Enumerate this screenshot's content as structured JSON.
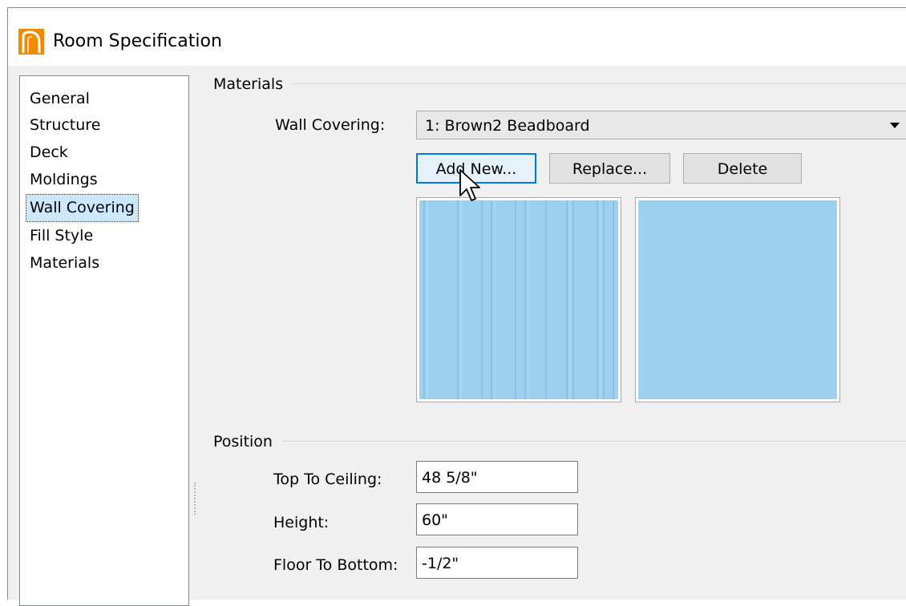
{
  "window": {
    "title": "Room Specification"
  },
  "sidebar": {
    "items": [
      {
        "label": "General",
        "selected": false
      },
      {
        "label": "Structure",
        "selected": false
      },
      {
        "label": "Deck",
        "selected": false
      },
      {
        "label": "Moldings",
        "selected": false
      },
      {
        "label": "Wall Covering",
        "selected": true
      },
      {
        "label": "Fill Style",
        "selected": false
      },
      {
        "label": "Materials",
        "selected": false
      }
    ]
  },
  "materials": {
    "group_title": "Materials",
    "wall_covering_label": "Wall Covering:",
    "wall_covering_value": "1:  Brown2 Beadboard",
    "buttons": {
      "add_new": "Add New...",
      "replace": "Replace...",
      "delete": "Delete"
    },
    "swatch_color": "#9dd0ef"
  },
  "position": {
    "group_title": "Position",
    "top_to_ceiling_label": "Top To Ceiling:",
    "top_to_ceiling_value": "48 5/8\"",
    "height_label": "Height:",
    "height_value": "60\"",
    "floor_to_bottom_label": "Floor To Bottom:",
    "floor_to_bottom_value": "-1/2\""
  },
  "colors": {
    "accent": "#0078d7",
    "selection": "#cce8ff",
    "app_icon": "#f08a00"
  }
}
